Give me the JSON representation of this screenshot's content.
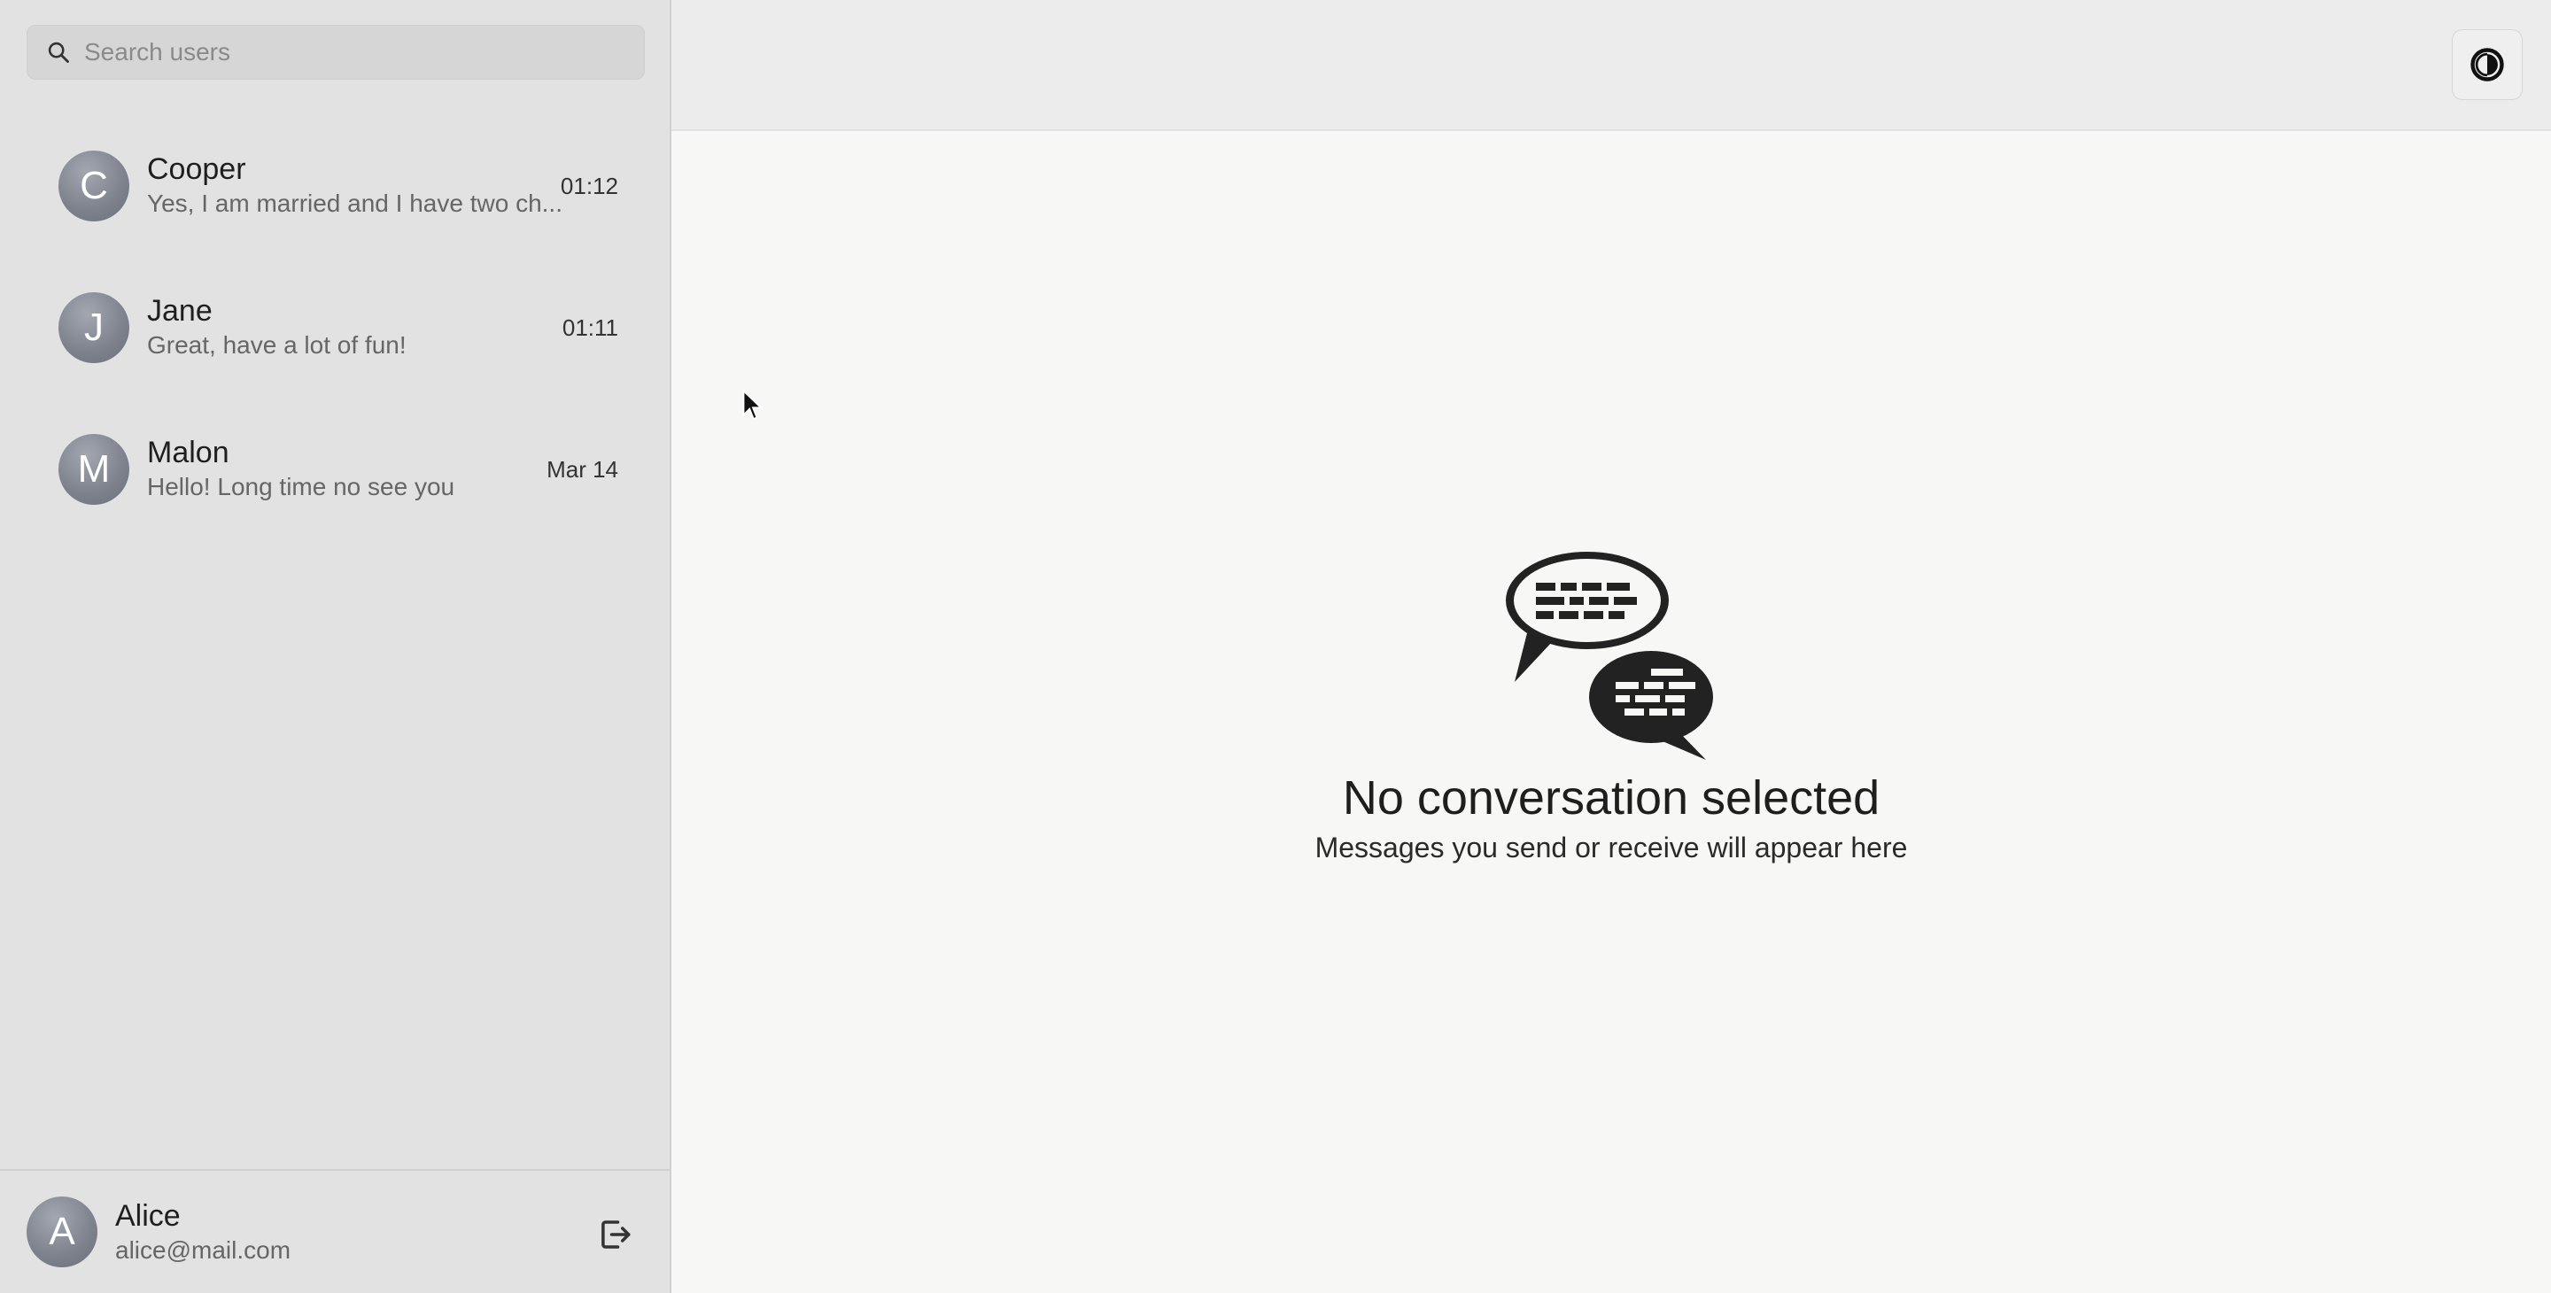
{
  "search": {
    "placeholder": "Search users"
  },
  "conversations": [
    {
      "initial": "C",
      "name": "Cooper",
      "preview": "Yes, I am married and I have two ch...",
      "time": "01:12"
    },
    {
      "initial": "J",
      "name": "Jane",
      "preview": "Great, have a lot of fun!",
      "time": "01:11"
    },
    {
      "initial": "M",
      "name": "Malon",
      "preview": "Hello! Long time no see you",
      "time": "Mar 14"
    }
  ],
  "current_user": {
    "initial": "A",
    "name": "Alice",
    "email": "alice@mail.com"
  },
  "empty_state": {
    "title": "No conversation selected",
    "subtitle": "Messages you send or receive will appear here"
  },
  "icons": {
    "search": "search-icon",
    "logout": "logout-icon",
    "theme": "contrast-icon",
    "illustration": "chat-bubbles-icon"
  },
  "colors": {
    "sidebar_bg": "#e2e2e2",
    "main_bg": "#f7f7f6",
    "avatar": "#7c818c",
    "text_primary": "#1f1f1f",
    "text_secondary": "#666666"
  }
}
